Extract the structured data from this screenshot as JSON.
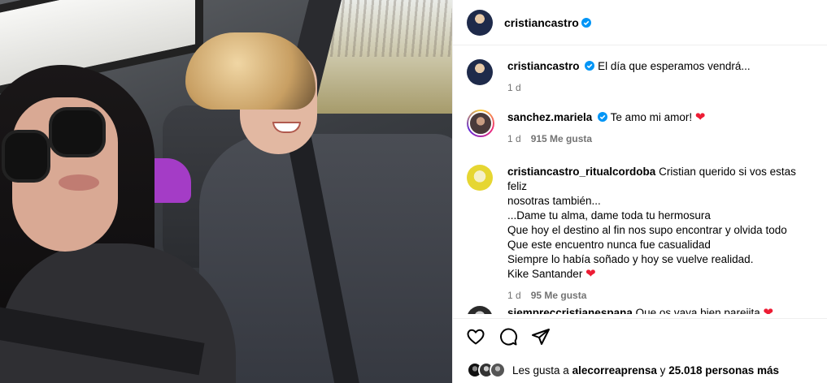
{
  "post": {
    "author": "cristiancastro",
    "verified_icon": "verified-badge-icon",
    "accent": "#0095f6"
  },
  "comments": [
    {
      "username": "cristiancastro",
      "verified": true,
      "text": "El día que esperamos vendrá...",
      "time": "1 d",
      "likes": ""
    },
    {
      "username": "sanchez.mariela",
      "verified": true,
      "text": "Te amo mi amor! ",
      "time": "1 d",
      "likes": "915 Me gusta"
    },
    {
      "username": "cristiancastro_ritualcordoba",
      "verified": false,
      "text_lines": [
        "Cristian querido si vos estas feliz",
        "nosotras también...",
        "...Dame tu alma, dame toda tu hermosura",
        "Que hoy el destino al fin nos supo encontrar y olvida todo",
        "Que este encuentro nunca fue casualidad",
        "Siempre lo había soñado y hoy se vuelve realidad.",
        "Kike Santander "
      ],
      "time": "1 d",
      "likes": "95 Me gusta"
    },
    {
      "username": "siempreccristianespana",
      "verified": false,
      "text": "Que os vaya bien pareiita "
    }
  ],
  "actions": {
    "like_icon": "heart-outline-icon",
    "comment_icon": "comment-bubble-icon",
    "share_icon": "paper-plane-icon"
  },
  "liked_by": {
    "prefix": "Les gusta a",
    "user": "alecorreaprensa",
    "middle": "y",
    "count": "25.018 personas más"
  },
  "colors": {
    "heart": "#ed1c34",
    "secondary_text": "#737373",
    "border": "#efefef"
  }
}
